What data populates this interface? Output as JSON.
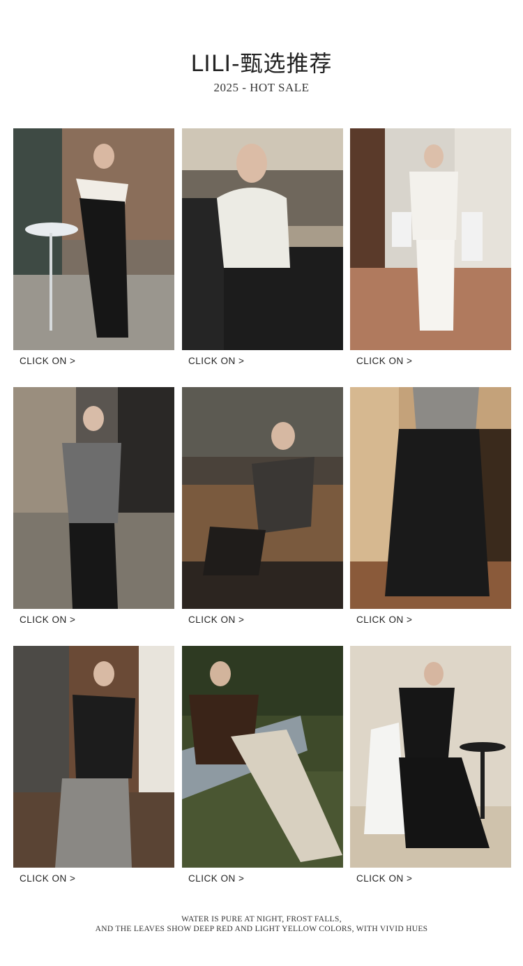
{
  "header": {
    "title": "LILI-甄选推荐",
    "subtitle": "2025 - HOT SALE"
  },
  "products": [
    {
      "image": "look-1-off-shoulder-black-white-top",
      "link_label": "CLICK ON >"
    },
    {
      "image": "look-2-cream-knit-vest",
      "link_label": "CLICK ON >"
    },
    {
      "image": "look-3-white-knit-set",
      "link_label": "CLICK ON >"
    },
    {
      "image": "look-4-grey-wrap-top",
      "link_label": "CLICK ON >"
    },
    {
      "image": "look-5-charcoal-cardigan",
      "link_label": "CLICK ON >"
    },
    {
      "image": "look-6-black-wide-pants",
      "link_label": "CLICK ON >"
    },
    {
      "image": "look-7-black-off-shoulder-grey-pants",
      "link_label": "CLICK ON >"
    },
    {
      "image": "look-8-brown-scarf-linen-pants",
      "link_label": "CLICK ON >"
    },
    {
      "image": "look-9-black-maxi-dress",
      "link_label": "CLICK ON >"
    }
  ],
  "footer": {
    "line1": "WATER IS PURE AT NIGHT, FROST FALLS,",
    "line2": "AND THE LEAVES SHOW DEEP RED AND LIGHT YELLOW COLORS, WITH VIVID HUES"
  }
}
